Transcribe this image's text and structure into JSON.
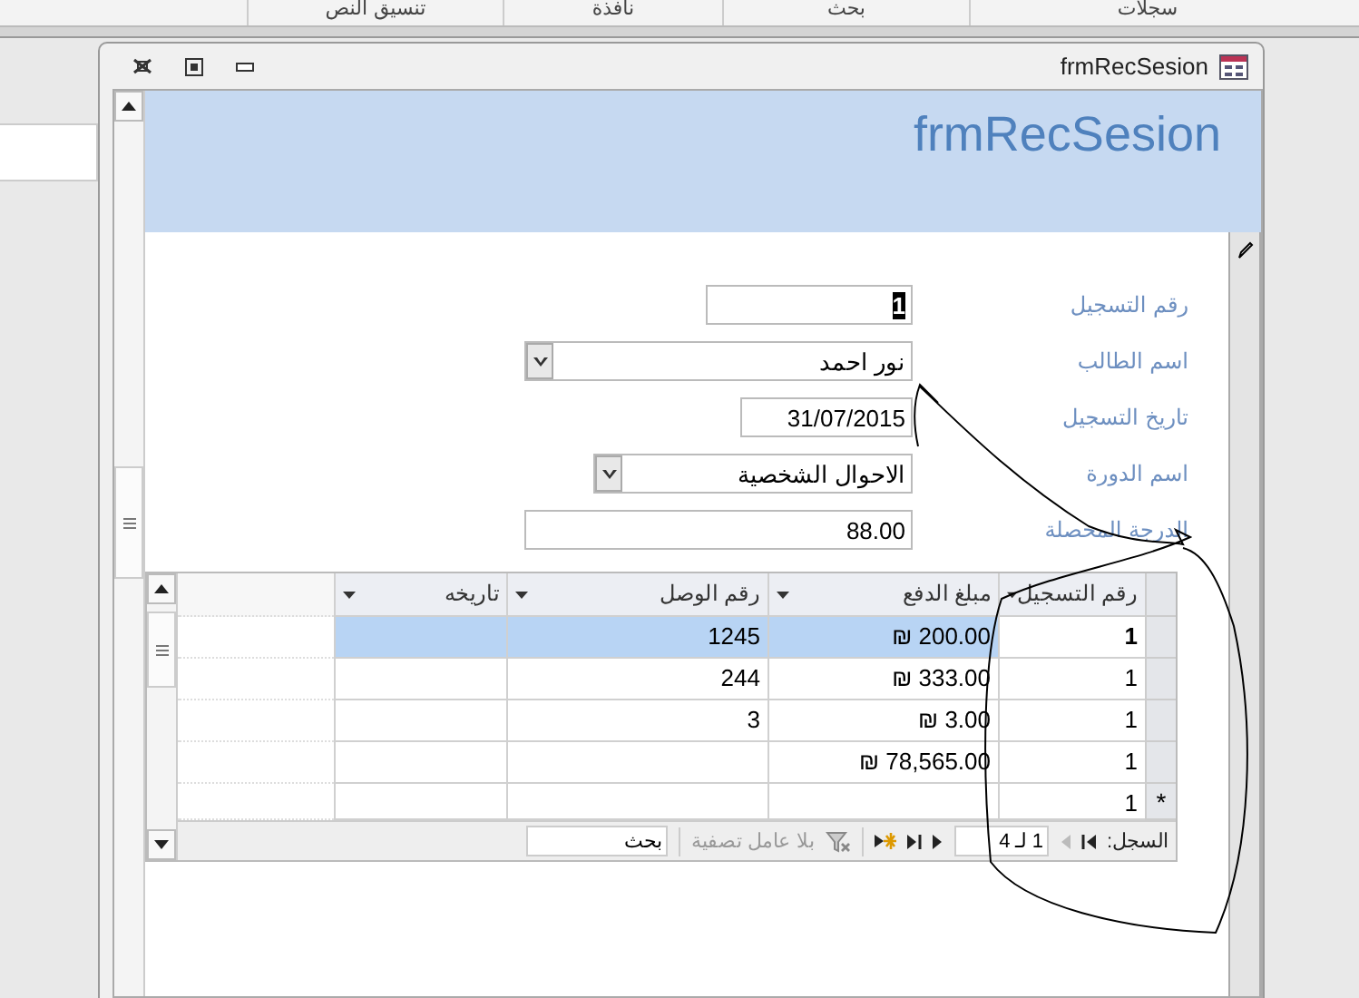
{
  "menu": [
    {
      "label": "سجلات"
    },
    {
      "label": "بحث"
    },
    {
      "label": "نافذة"
    },
    {
      "label": "تنسيق النص"
    }
  ],
  "window": {
    "title": "frmRecSesion"
  },
  "form": {
    "header_title": "frmRecSesion",
    "fields": [
      {
        "kind": "text",
        "label": "رقم التسجيل",
        "value": "1",
        "focused": true
      },
      {
        "kind": "combo",
        "label": "اسم الطالب",
        "value": "نور احمد",
        "focused": false
      },
      {
        "kind": "text",
        "label": "تاريخ التسجيل",
        "value": "31/07/2015",
        "focused": false
      },
      {
        "kind": "combo",
        "label": "اسم الدورة",
        "value": "الاحوال الشخصية",
        "focused": false
      },
      {
        "kind": "text",
        "label": "الدرجة المحصلة",
        "value": "88.00",
        "focused": false
      }
    ]
  },
  "subform": {
    "columns": [
      "رقم التسجيل",
      "مبلغ الدفع",
      "رقم الوصل",
      "تاريخه"
    ],
    "rows": [
      {
        "cells": [
          "1",
          "₪ 200.00",
          "1245",
          ""
        ],
        "selected": true,
        "new": false
      },
      {
        "cells": [
          "1",
          "₪ 333.00",
          "244",
          ""
        ],
        "selected": false,
        "new": false
      },
      {
        "cells": [
          "1",
          "₪ 3.00",
          "3",
          ""
        ],
        "selected": false,
        "new": false
      },
      {
        "cells": [
          "1",
          "₪ 78,565.00",
          "",
          ""
        ],
        "selected": false,
        "new": false
      },
      {
        "cells": [
          "1",
          "",
          "",
          ""
        ],
        "selected": false,
        "new": true,
        "marker": "*"
      }
    ],
    "navigator": {
      "label": "السجل:",
      "position": "1 لـ 4",
      "filter": "بلا عامل تصفية",
      "search_placeholder": "بحث"
    }
  }
}
